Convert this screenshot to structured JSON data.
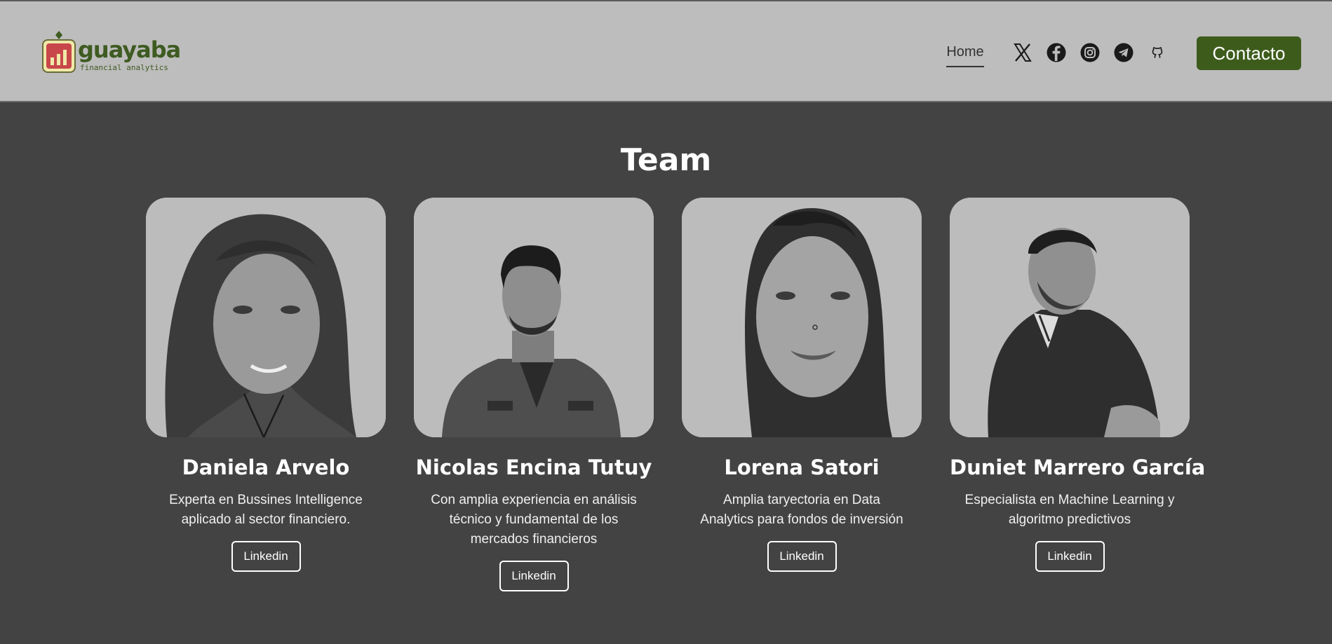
{
  "brand": {
    "name": "guayaba",
    "tagline": "financial analytics",
    "logo_colors": {
      "badge": "#c8474b",
      "frame": "#efe9a8",
      "text": "#3e5b21"
    }
  },
  "nav": {
    "home_label": "Home",
    "social_icons": [
      "x-icon",
      "facebook-icon",
      "instagram-icon",
      "telegram-icon",
      "github-icon"
    ],
    "contact_label": "Contacto"
  },
  "team": {
    "title": "Team",
    "members": [
      {
        "name": "Daniela Arvelo",
        "description": "Experta en Bussines Intelligence aplicado al sector financiero.",
        "button_label": "Linkedin"
      },
      {
        "name": "Nicolas Encina Tutuy",
        "description": "Con amplia experiencia en análisis técnico y fundamental de los mercados financieros",
        "button_label": "Linkedin"
      },
      {
        "name": "Lorena Satori",
        "description": "Amplia taryectoria en Data Analytics para fondos de inversión",
        "button_label": "Linkedin"
      },
      {
        "name": "Duniet Marrero García",
        "description": "Especialista en Machine Learning y algoritmo predictivos",
        "button_label": "Linkedin"
      }
    ]
  },
  "colors": {
    "header_bg": "#bdbdbd",
    "page_bg": "#434343",
    "accent": "#3d5c1c",
    "text": "#ffffff"
  }
}
